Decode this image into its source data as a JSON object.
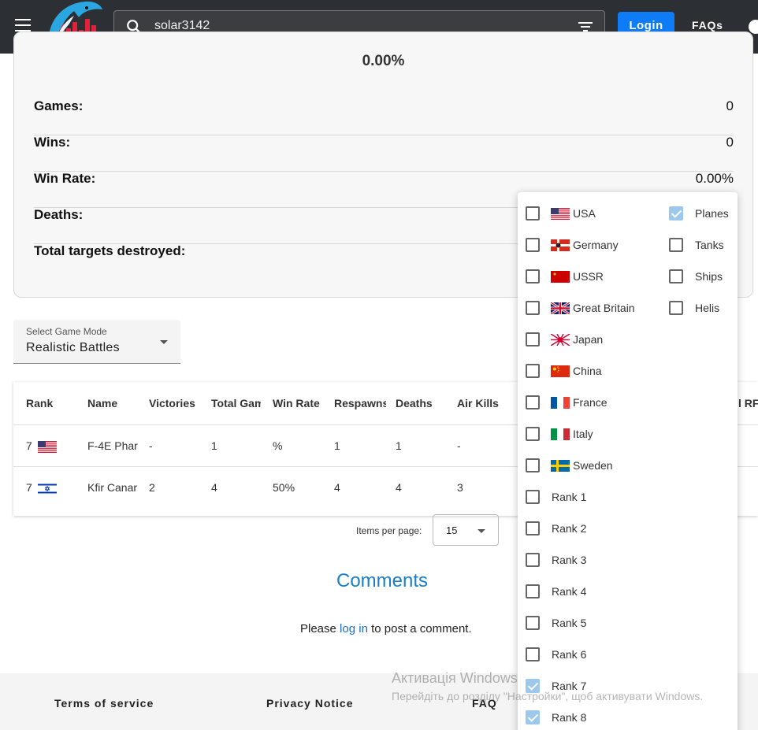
{
  "header": {
    "search_value": "solar3142",
    "login_label": "Login",
    "faq_label": "FAQs"
  },
  "stats": {
    "top_value": "0.00%",
    "rows": [
      {
        "label": "Games:",
        "value": "0"
      },
      {
        "label": "Wins:",
        "value": "0"
      },
      {
        "label": "Win Rate:",
        "value": "0.00%"
      },
      {
        "label": "Deaths:",
        "value": ""
      },
      {
        "label": "Total targets destroyed:",
        "value": ""
      }
    ]
  },
  "game_mode": {
    "label": "Select Game Mode",
    "value": "Realistic Battles"
  },
  "table": {
    "headers": [
      "Rank",
      "Name",
      "Victories",
      "Total Gam",
      "Win Rate",
      "Respawns",
      "Deaths",
      "Air Kills",
      "l RF"
    ],
    "rows": [
      {
        "rank": "7",
        "flag": "usa",
        "name": "F-4E Phar",
        "victories": "-",
        "total_games": "1",
        "win_rate": "%",
        "respawns": "1",
        "deaths": "1",
        "air_kills": "-"
      },
      {
        "rank": "7",
        "flag": "israel",
        "name": "Kfir Canar",
        "victories": "2",
        "total_games": "4",
        "win_rate": "50%",
        "respawns": "4",
        "deaths": "4",
        "air_kills": "3"
      }
    ]
  },
  "pagination": {
    "items_label": "Items per page:",
    "per_page": "15"
  },
  "comments": {
    "title": "Comments",
    "prefix": "Please",
    "link": "log in",
    "suffix": "to post a comment."
  },
  "footer": {
    "terms": "Terms of service",
    "privacy": "Privacy Notice",
    "faq": "FAQ"
  },
  "watermark": {
    "line1": "Активація Windows",
    "line2": "Перейдіть до розділу \"Настройки\", щоб активувати Windows."
  },
  "filters": {
    "nations": [
      {
        "label": "USA",
        "flag": "usa",
        "checked": false
      },
      {
        "label": "Germany",
        "flag": "germany",
        "checked": false
      },
      {
        "label": "USSR",
        "flag": "ussr",
        "checked": false
      },
      {
        "label": "Great Britain",
        "flag": "uk",
        "checked": false
      },
      {
        "label": "Japan",
        "flag": "japan",
        "checked": false
      },
      {
        "label": "China",
        "flag": "china",
        "checked": false
      },
      {
        "label": "France",
        "flag": "france",
        "checked": false
      },
      {
        "label": "Italy",
        "flag": "italy",
        "checked": false
      },
      {
        "label": "Sweden",
        "flag": "sweden",
        "checked": false
      }
    ],
    "vehicle_types": [
      {
        "label": "Planes",
        "checked": true
      },
      {
        "label": "Tanks",
        "checked": false
      },
      {
        "label": "Ships",
        "checked": false
      },
      {
        "label": "Helis",
        "checked": false
      }
    ],
    "ranks": [
      {
        "label": "Rank 1",
        "checked": false
      },
      {
        "label": "Rank 2",
        "checked": false
      },
      {
        "label": "Rank 3",
        "checked": false
      },
      {
        "label": "Rank 4",
        "checked": false
      },
      {
        "label": "Rank 5",
        "checked": false
      },
      {
        "label": "Rank 6",
        "checked": false
      },
      {
        "label": "Rank 7",
        "checked": true
      },
      {
        "label": "Rank 8",
        "checked": true
      }
    ]
  }
}
